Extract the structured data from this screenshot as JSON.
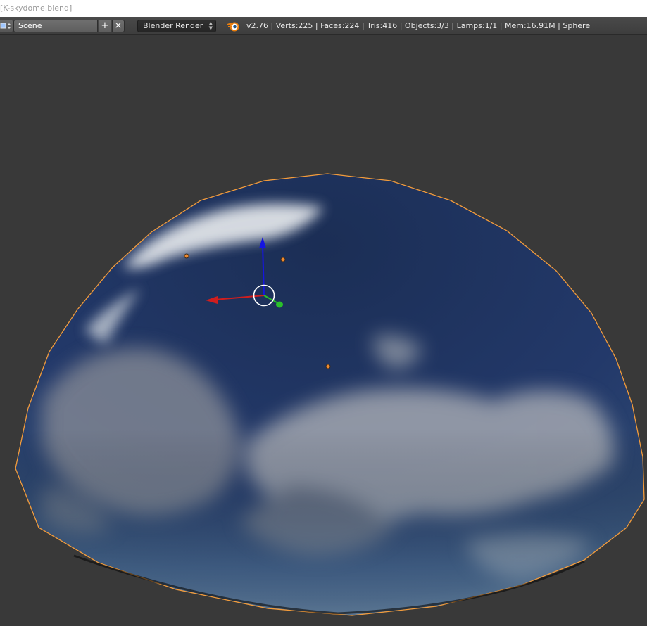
{
  "window": {
    "title": "[K-skydome.blend]"
  },
  "header": {
    "editor_type_icon": "3d-view-icon",
    "scene_name": "Scene",
    "scene_add_icon": "plus-icon",
    "scene_remove_icon": "x-icon",
    "render_engine": "Blender Render",
    "logo_icon": "blender-logo-icon",
    "stats": "v2.76 | Verts:225 | Faces:224 | Tris:416 | Objects:3/3 | Lamps:1/1 | Mem:16.91M | Sphere"
  },
  "viewport": {
    "background_color": "#393939",
    "selection_outline_color": "#f39c3c",
    "sky_color": "#1e3358",
    "gizmo": {
      "x_axis_color": "#d01e1e",
      "y_axis_color": "#2ac02a",
      "z_axis_color": "#1515e0"
    }
  }
}
